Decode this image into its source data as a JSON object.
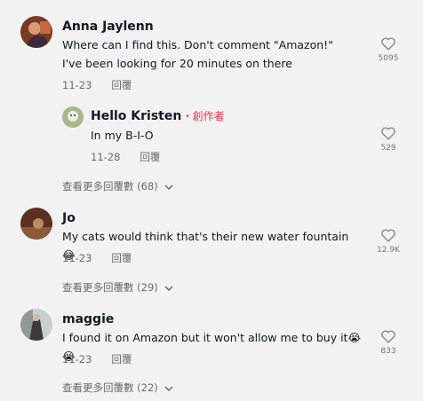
{
  "comments": [
    {
      "name": "Anna Jaylenn",
      "text": "Where can I find this. Don't comment \"Amazon!\" I've been looking for 20 minutes on there",
      "date": "11-23",
      "reply_label": "回覆",
      "likes": "5095",
      "avatar_color": "#8a4a30",
      "replies": [
        {
          "name": "Hello Kristen",
          "badge": "創作者",
          "text": "In my B-I-O",
          "date": "11-28",
          "reply_label": "回覆",
          "likes": "529",
          "avatar_color": "#b8c7a0"
        }
      ],
      "view_more": "查看更多回覆數 (68)"
    },
    {
      "name": "Jo",
      "text": "My cats would think that's their new water fountain 😂",
      "date": "11-23",
      "reply_label": "回覆",
      "likes": "12.9K",
      "avatar_color": "#6b3f2a",
      "view_more": "查看更多回覆數 (29)"
    },
    {
      "name": "maggie",
      "text": "I found it on Amazon but it won't allow me to buy it😭😭",
      "date": "11-23",
      "reply_label": "回覆",
      "likes": "833",
      "avatar_color": "#9aa3a0",
      "view_more": "查看更多回覆數 (22)"
    }
  ],
  "icons": {
    "like": "heart-outline-icon",
    "chevron": "chevron-down-icon"
  }
}
